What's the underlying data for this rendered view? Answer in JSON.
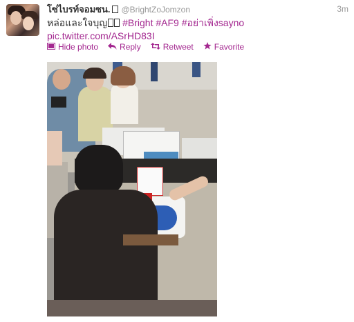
{
  "tweet": {
    "fullname": "โซ่ไบรท์จอมซน.",
    "username": "@BrightZoJomzon",
    "time": "3m",
    "text_prefix": "หล่อและใจบุญ",
    "hashtag1": "#Bright",
    "hashtag2": "#AF9",
    "hashtag3": "#อย่าเพิ่งsayno",
    "media_link": "pic.twitter.com/ASrHD83I"
  },
  "actions": {
    "hide_photo": "Hide photo",
    "reply": "Reply",
    "retweet": "Retweet",
    "favorite": "Favorite"
  },
  "colors": {
    "link": "#a3278f",
    "muted": "#999999",
    "text": "#333333"
  },
  "icons": [
    "photo-icon",
    "reply-icon",
    "retweet-icon",
    "star-icon"
  ]
}
